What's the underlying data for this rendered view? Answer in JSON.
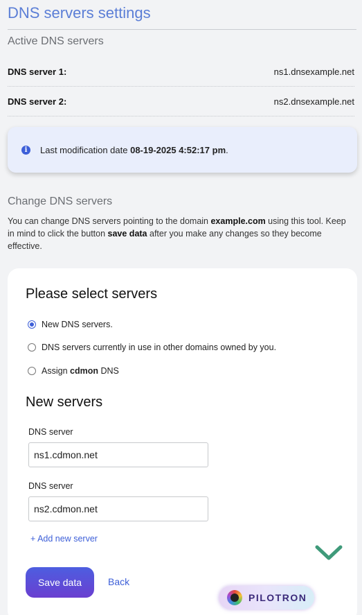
{
  "page": {
    "title": "DNS servers settings"
  },
  "active": {
    "title": "Active DNS servers",
    "rows": [
      {
        "label": "DNS server 1:",
        "value": "ns1.dnsexample.net"
      },
      {
        "label": "DNS server 2:",
        "value": "ns2.dnsexample.net"
      }
    ]
  },
  "info": {
    "icon": "info-icon",
    "prefix": "Last modification date",
    "date": "08-19-2025 4:52:17 pm",
    "suffix": "."
  },
  "change": {
    "title": "Change DNS servers",
    "desc_part1": "You can change DNS servers pointing to the domain ",
    "domain": "example.com",
    "desc_part2": " using this tool. Keep in mind to click the button ",
    "button_ref": "save data",
    "desc_part3": " after you make any changes so they become effective."
  },
  "card": {
    "title": "Please select servers",
    "options": [
      {
        "label": "New DNS servers.",
        "checked": true
      },
      {
        "label": "DNS servers currently in use in other domains owned by you.",
        "checked": false
      }
    ],
    "assign_prefix": "Assign ",
    "assign_brand": "cdmon",
    "assign_suffix": " DNS",
    "new_servers_title": "New servers",
    "fields": [
      {
        "label": "DNS server",
        "value": "ns1.cdmon.net"
      },
      {
        "label": "DNS server",
        "value": "ns2.cdmon.net"
      }
    ],
    "add_link": "+ Add new server",
    "save_label": "Save data",
    "back_label": "Back"
  },
  "widget": {
    "name": "PILOTRON"
  },
  "colors": {
    "accent": "#3d5fd8",
    "title": "#5b7ed6",
    "chevron": "#3f9a7a"
  }
}
